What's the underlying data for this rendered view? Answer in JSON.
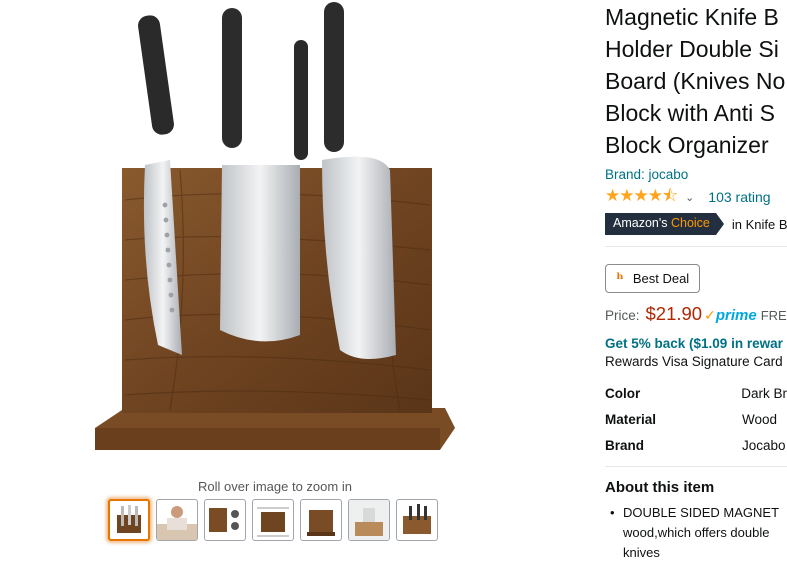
{
  "gallery": {
    "zoom_hint": "Roll over image to zoom in",
    "main_image_icon": "knife-block-product-photo",
    "thumbnail_count": 7,
    "selected_thumbnail": 1
  },
  "product": {
    "title_lines": [
      "Magnetic Knife B",
      "Holder Double Si",
      "Board (Knives No",
      "Block with Anti S",
      "Block Organizer"
    ],
    "brand": "Brand: jocabo",
    "rating_stars": "★★★★⯪",
    "rating_count": "103 rating",
    "choice_badge_prefix": "Amazon's ",
    "choice_badge_accent": "Choice",
    "choice_category": "in Knife B",
    "deal_label": "Best Deal",
    "price_label": "Price:",
    "price": "$21.90",
    "prime": "prime",
    "prime_suffix": "FRE",
    "cashback": "Get 5% back ($1.09 in rewar",
    "card_text": "Rewards Visa Signature Card",
    "specs": [
      {
        "key": "Color",
        "value": "Dark Br"
      },
      {
        "key": "Material",
        "value": "Wood"
      },
      {
        "key": "Brand",
        "value": "Jocabo"
      }
    ],
    "about_heading": "About this item",
    "bullet_lines": [
      "DOUBLE SIDED MAGNET",
      "wood,which offers double",
      "knives"
    ]
  },
  "colors": {
    "link": "#007185",
    "price": "#b12704",
    "star": "#ffa41c",
    "badge_bg": "#232f3e",
    "badge_accent": "#ff9900",
    "prime": "#00a8e1",
    "selected_thumb": "#e77600"
  }
}
